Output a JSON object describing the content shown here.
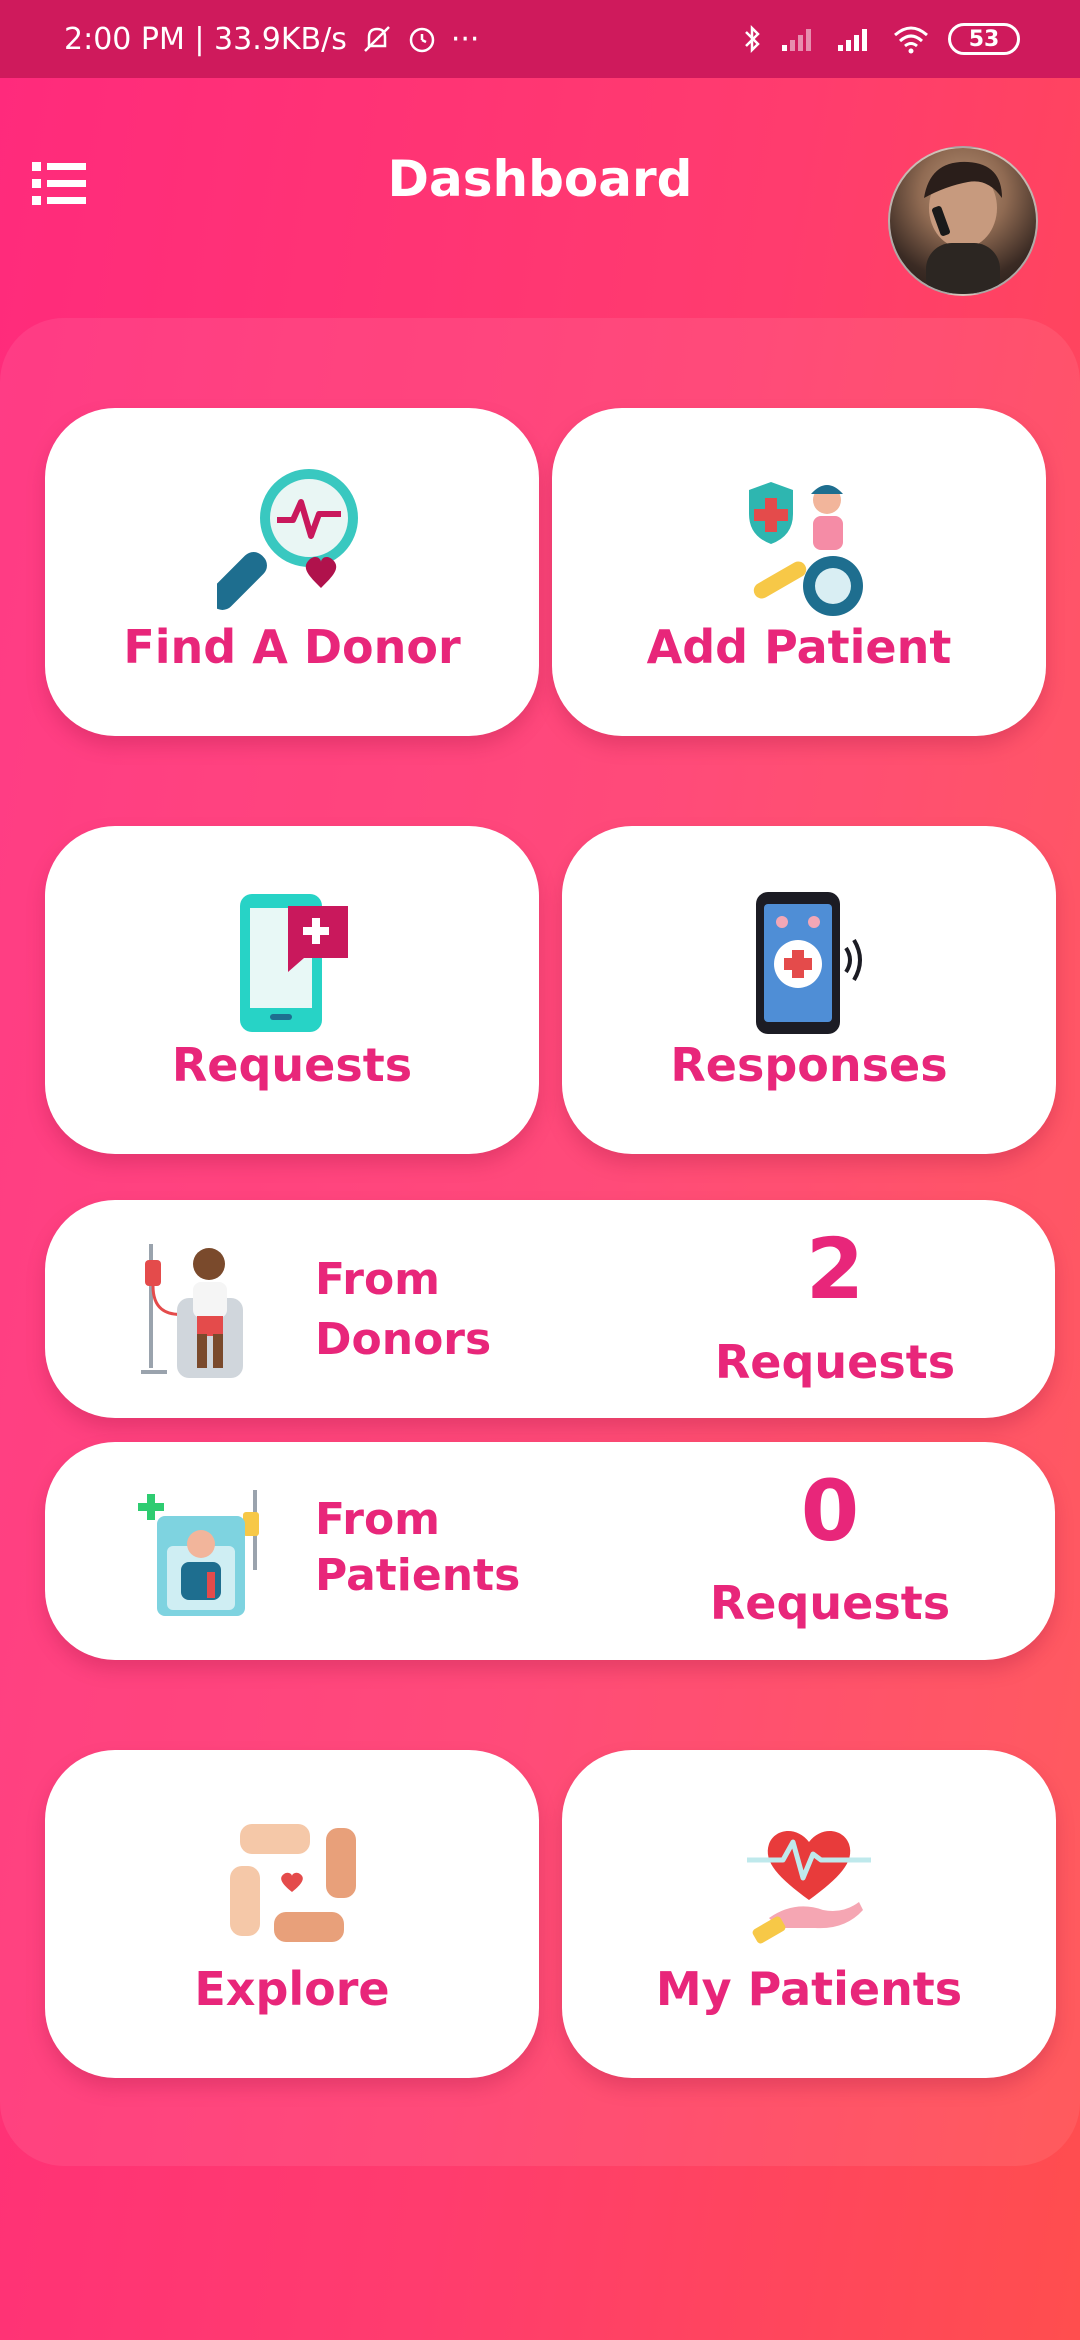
{
  "status_bar": {
    "time_speed": "2:00 PM | 33.9KB/s",
    "more": "···",
    "battery": "53"
  },
  "header": {
    "title": "Dashboard",
    "menu_icon": "list-menu-icon",
    "avatar_icon": "profile-avatar"
  },
  "cards": {
    "find_donor": {
      "label": "Find A Donor",
      "icon": "magnifier-heart-icon"
    },
    "add_patient": {
      "label": "Add Patient",
      "icon": "patient-wheelchair-icon"
    },
    "requests": {
      "label": "Requests",
      "icon": "phone-request-icon"
    },
    "responses": {
      "label": "Responses",
      "icon": "phone-response-icon"
    },
    "explore": {
      "label": "Explore",
      "icon": "hands-heart-icon"
    },
    "my_patients": {
      "label": "My Patients",
      "icon": "hand-heart-icon"
    }
  },
  "summary": {
    "from_donors": {
      "line1": "From",
      "line2": "Donors",
      "count": "2",
      "count_label": "Requests"
    },
    "from_patients": {
      "line1": "From",
      "line2": "Patients",
      "count": "0",
      "count_label": "Requests"
    }
  },
  "colors": {
    "accent": "#e8267a",
    "status_bar": "#cf1a5c",
    "background_start": "#ff2a7c",
    "background_end": "#ff4e4e"
  }
}
